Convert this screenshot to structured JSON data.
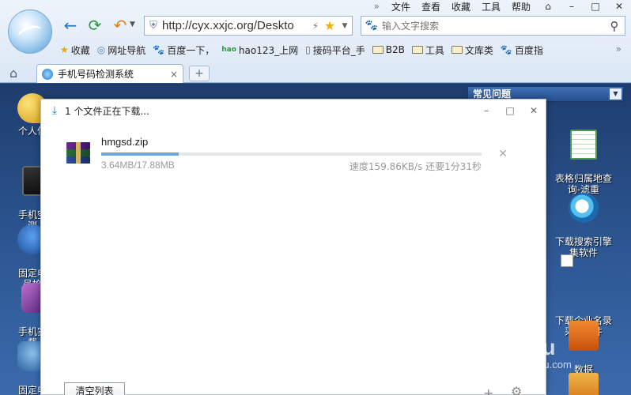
{
  "menubar": {
    "more": "»",
    "items": [
      "文件",
      "查看",
      "收藏",
      "工具",
      "帮助"
    ],
    "controls": [
      "⌂",
      "–",
      "□",
      "✕"
    ]
  },
  "address": {
    "url": "http://cyx.xxjc.org/Deskto"
  },
  "search": {
    "placeholder": "输入文字搜索"
  },
  "bookmarks": [
    {
      "label": "收藏",
      "icon": "star-icon"
    },
    {
      "label": "网址导航",
      "icon": "globe-icon"
    },
    {
      "label": "百度一下，",
      "icon": "paw-icon"
    },
    {
      "label": "hao123_上网",
      "icon": "hao-icon"
    },
    {
      "label": "接码平台_手",
      "icon": "page-icon"
    },
    {
      "label": "B2B",
      "icon": "folder-icon"
    },
    {
      "label": "工具",
      "icon": "folder-icon"
    },
    {
      "label": "文库类",
      "icon": "folder-icon"
    },
    {
      "label": "百度指",
      "icon": "paw-icon"
    }
  ],
  "bookmarks_more": "»",
  "tab": {
    "label": "手机号码检测系统",
    "close": "×",
    "new": "+"
  },
  "desktop": {
    "left_icons": [
      {
        "label": "个人信"
      },
      {
        "label": "手机空\n测"
      },
      {
        "label": "固定电\n号检"
      },
      {
        "label": "手机实\n载"
      },
      {
        "label": "固定电\n号下"
      }
    ],
    "right_icons": [
      {
        "label": "表格归属地查\n询-滤重"
      },
      {
        "label": "下载搜索引擎\n集软件"
      },
      {
        "label": "下载企业名录\n采集软件"
      },
      {
        "label": "数据\n集软件"
      }
    ],
    "faq": "常见问题"
  },
  "download": {
    "title": "1 个文件正在下载...",
    "file_name": "hmgsd.zip",
    "sizes": "3.64MB/17.88MB",
    "progress": 0.2036,
    "speed": "速度159.86KB/s 还要1分31秒",
    "clear_label": "清空列表"
  },
  "watermark": {
    "line1": "Bai du",
    "line2": "jingyan.baidu.com"
  },
  "colors": {
    "accent": "#2e78d2",
    "progress": "#6ea7dc"
  }
}
